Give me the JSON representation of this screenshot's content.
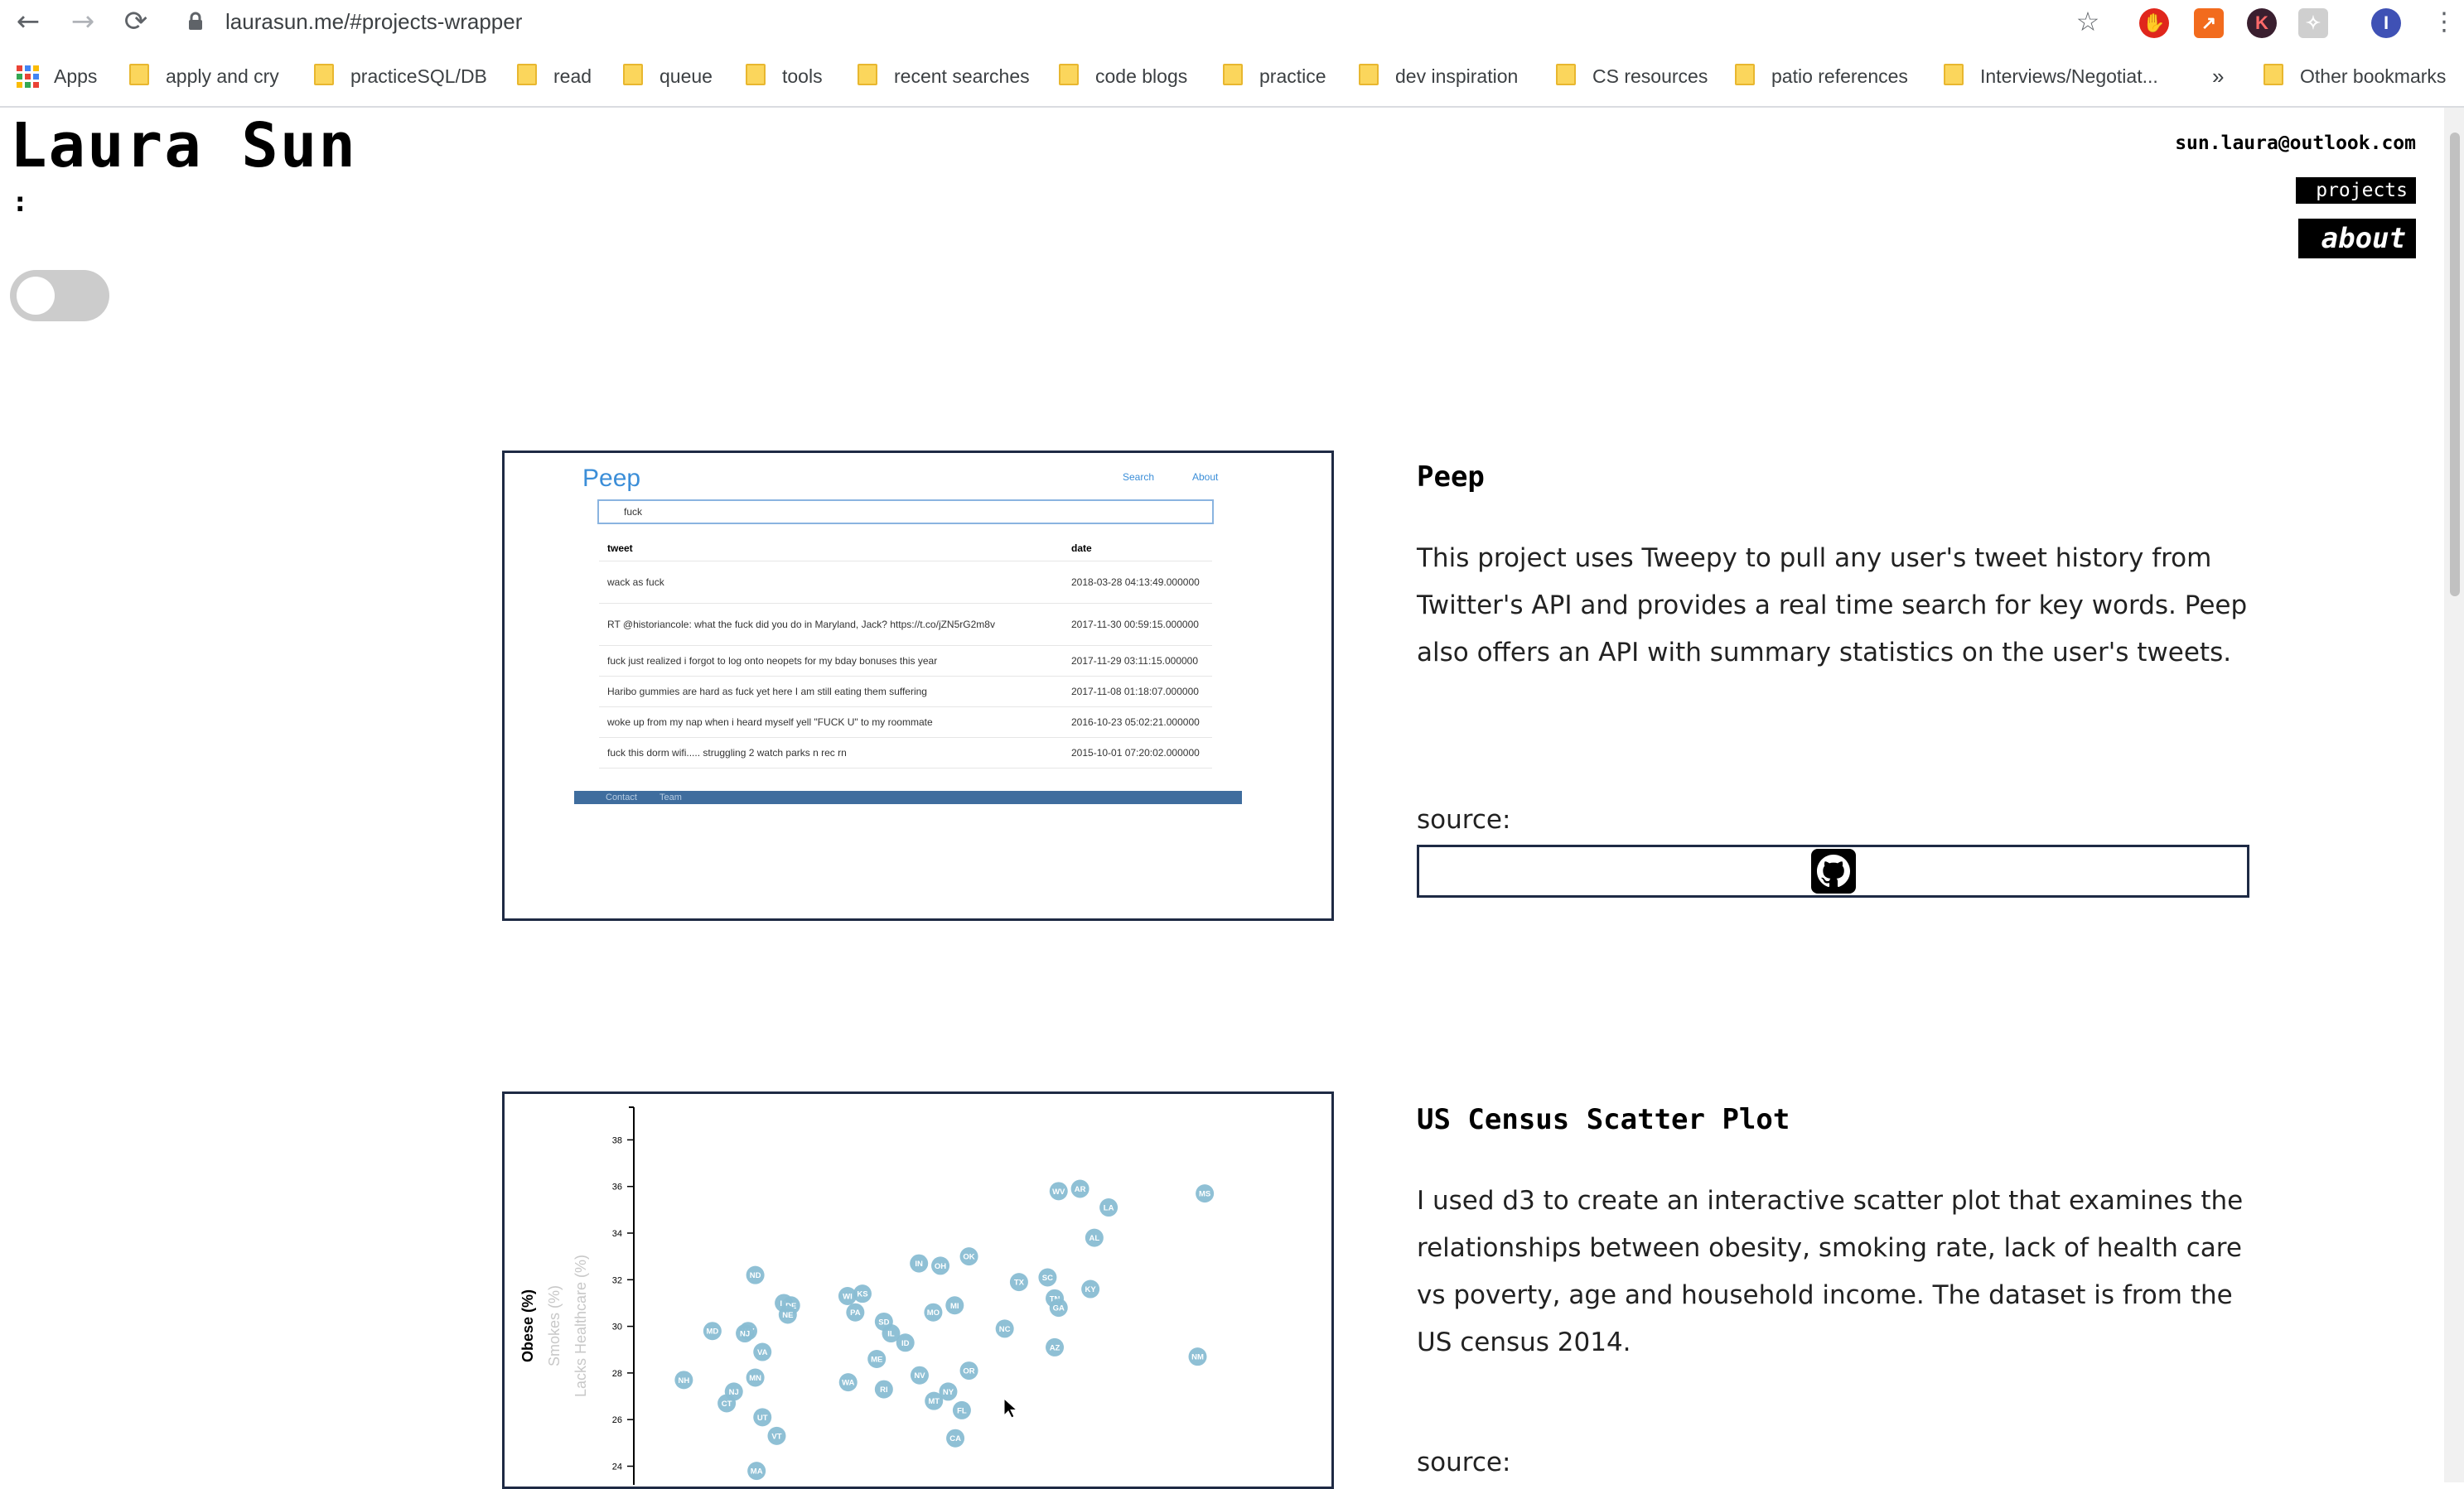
{
  "browser": {
    "url": "laurasun.me/#projects-wrapper",
    "extensions": [
      {
        "icon": "adblock-icon",
        "color": "#e0261c",
        "glyph": "✋"
      },
      {
        "icon": "trend-chart-icon",
        "color": "#f26b1d",
        "glyph": "↗"
      },
      {
        "icon": "k-extension-icon",
        "color": "#3a1f2f",
        "glyph": "K"
      },
      {
        "icon": "puzzle-extension-icon",
        "color": "#cfcfcf",
        "glyph": "✧"
      },
      {
        "icon": "profile-avatar-icon",
        "color": "#3f51b5",
        "glyph": "I"
      }
    ],
    "bookmarks": [
      "Apps",
      "apply and cry",
      "practiceSQL/DB",
      "read",
      "queue",
      "tools",
      "recent searches",
      "code blogs",
      "practice",
      "dev inspiration",
      "CS resources",
      "patio references",
      "Interviews/Negotiat...",
      "»",
      "Other bookmarks"
    ]
  },
  "header": {
    "name": "Laura Sun",
    "colon": ":",
    "email": "sun.laura@outlook.com",
    "nav": {
      "projects": "projects",
      "about": "about"
    }
  },
  "projects": [
    {
      "title": "Peep",
      "description": "This project uses Tweepy to pull any user's tweet history from Twitter's API and provides a real time search for key words. Peep also offers an API with summary statistics on the user's tweets.",
      "source_label": "source:",
      "preview": {
        "brand": "Peep",
        "nav": [
          "Search",
          "About"
        ],
        "search_value": "fuck",
        "columns": [
          "tweet",
          "date"
        ],
        "rows": [
          [
            "wack as fuck",
            "2018-03-28 04:13:49.000000"
          ],
          [
            "RT @historiancole: what the fuck did you do in Maryland, Jack? https://t.co/jZN5rG2m8v",
            "2017-11-30 00:59:15.000000"
          ],
          [
            "fuck just realized i forgot to log onto neopets for my bday bonuses this year",
            "2017-11-29 03:11:15.000000"
          ],
          [
            "Haribo gummies are hard as fuck yet here I am still eating them suffering",
            "2017-11-08 01:18:07.000000"
          ],
          [
            "woke up from my nap when i heard myself yell \"FUCK U\" to my roommate",
            "2016-10-23 05:02:21.000000"
          ],
          [
            "fuck this dorm wifi..... struggling 2 watch parks n rec rn",
            "2015-10-01 07:20:02.000000"
          ]
        ],
        "footer": [
          "Contact",
          "Team"
        ]
      }
    },
    {
      "title": "US Census Scatter Plot",
      "description": "I used d3 to create an interactive scatter plot that examines the relationships between obesity, smoking rate, lack of health care vs poverty, age and household income. The dataset is from the US census 2014.",
      "source_label": "source:"
    }
  ],
  "chart_data": {
    "type": "scatter",
    "title": "",
    "ylabels": [
      "Obese (%)",
      "Smokes (%)",
      "Lacks Healthcare (%)"
    ],
    "active_ylabel": "Obese (%)",
    "yticks": [
      24,
      26,
      28,
      30,
      32,
      34,
      36,
      38
    ],
    "ylim": [
      23.2,
      39.4
    ],
    "xlim": [
      0,
      1
    ],
    "point_color": "#89bdd3",
    "points": [
      {
        "label": "WV",
        "x": 0.654,
        "y": 35.8
      },
      {
        "label": "AR",
        "x": 0.687,
        "y": 35.9
      },
      {
        "label": "LA",
        "x": 0.731,
        "y": 35.1
      },
      {
        "label": "MS",
        "x": 0.879,
        "y": 35.7
      },
      {
        "label": "AL",
        "x": 0.709,
        "y": 33.8
      },
      {
        "label": "OK",
        "x": 0.516,
        "y": 33.0
      },
      {
        "label": "IN",
        "x": 0.439,
        "y": 32.7
      },
      {
        "label": "OH",
        "x": 0.472,
        "y": 32.6
      },
      {
        "label": "SC",
        "x": 0.637,
        "y": 32.1
      },
      {
        "label": "TX",
        "x": 0.593,
        "y": 31.9
      },
      {
        "label": "KY",
        "x": 0.703,
        "y": 31.6
      },
      {
        "label": "TN",
        "x": 0.648,
        "y": 31.2
      },
      {
        "label": "ND",
        "x": 0.187,
        "y": 32.2
      },
      {
        "label": "WI",
        "x": 0.329,
        "y": 31.3
      },
      {
        "label": "KS",
        "x": 0.352,
        "y": 31.4
      },
      {
        "label": "MI",
        "x": 0.494,
        "y": 30.9
      },
      {
        "label": "GA",
        "x": 0.654,
        "y": 30.8
      },
      {
        "label": "IA",
        "x": 0.231,
        "y": 31.0
      },
      {
        "label": "DE",
        "x": 0.242,
        "y": 30.9
      },
      {
        "label": "NE",
        "x": 0.237,
        "y": 30.5
      },
      {
        "label": "PA",
        "x": 0.341,
        "y": 30.6
      },
      {
        "label": "MO",
        "x": 0.461,
        "y": 30.6
      },
      {
        "label": "SD",
        "x": 0.385,
        "y": 30.2
      },
      {
        "label": "IL",
        "x": 0.396,
        "y": 29.7
      },
      {
        "label": "NC",
        "x": 0.571,
        "y": 29.9
      },
      {
        "label": "MD",
        "x": 0.121,
        "y": 29.8
      },
      {
        "label": "WY",
        "x": 0.176,
        "y": 29.8
      },
      {
        "label": "NJ",
        "x": 0.171,
        "y": 29.7
      },
      {
        "label": "ID",
        "x": 0.418,
        "y": 29.3
      },
      {
        "label": "VA",
        "x": 0.198,
        "y": 28.9
      },
      {
        "label": "ME",
        "x": 0.374,
        "y": 28.6
      },
      {
        "label": "AZ",
        "x": 0.648,
        "y": 29.1
      },
      {
        "label": "NM",
        "x": 0.868,
        "y": 28.7
      },
      {
        "label": "NH",
        "x": 0.077,
        "y": 27.7
      },
      {
        "label": "MN",
        "x": 0.187,
        "y": 27.8
      },
      {
        "label": "WA",
        "x": 0.33,
        "y": 27.6
      },
      {
        "label": "NV",
        "x": 0.44,
        "y": 27.9
      },
      {
        "label": "OR",
        "x": 0.516,
        "y": 28.1
      },
      {
        "label": "RI",
        "x": 0.385,
        "y": 27.3
      },
      {
        "label": "NY",
        "x": 0.484,
        "y": 27.2
      },
      {
        "label": "NJ",
        "x": 0.154,
        "y": 27.2
      },
      {
        "label": "CT",
        "x": 0.143,
        "y": 26.7
      },
      {
        "label": "MT",
        "x": 0.462,
        "y": 26.8
      },
      {
        "label": "FL",
        "x": 0.505,
        "y": 26.4
      },
      {
        "label": "UT",
        "x": 0.198,
        "y": 26.1
      },
      {
        "label": "VT",
        "x": 0.22,
        "y": 25.3
      },
      {
        "label": "CA",
        "x": 0.495,
        "y": 25.2
      },
      {
        "label": "MA",
        "x": 0.189,
        "y": 23.8
      }
    ]
  }
}
